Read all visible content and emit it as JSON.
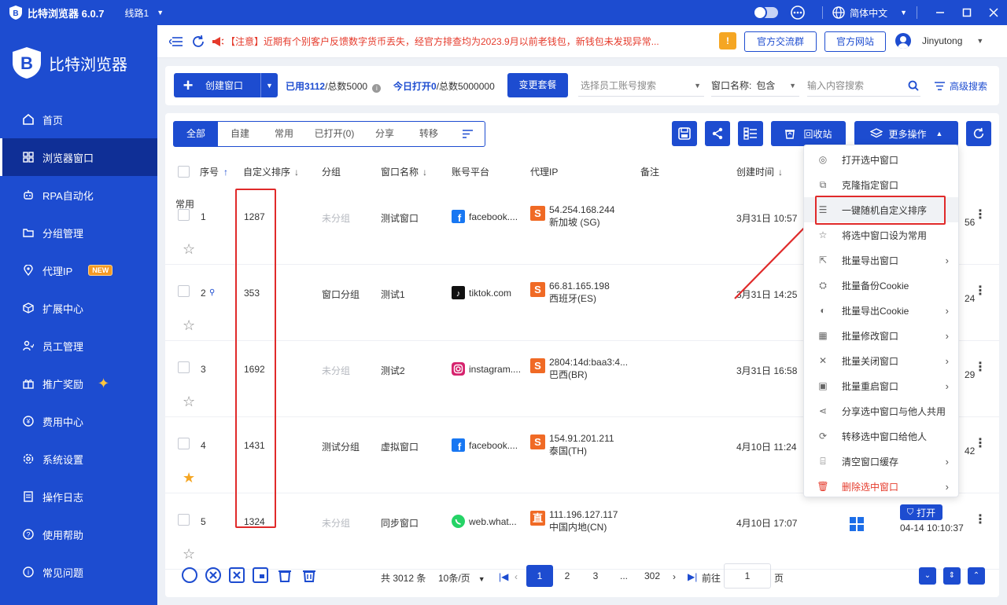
{
  "titlebar": {
    "app_title": "比特浏览器 6.0.7",
    "line_label": "线路1",
    "language": "简体中文"
  },
  "sidebar": {
    "brand": "比特浏览器",
    "items": [
      {
        "label": "首页",
        "icon": "home-icon"
      },
      {
        "label": "浏览器窗口",
        "icon": "grid-icon",
        "active": true
      },
      {
        "label": "RPA自动化",
        "icon": "rpa-icon"
      },
      {
        "label": "分组管理",
        "icon": "folder-icon"
      },
      {
        "label": "代理IP",
        "icon": "location-icon",
        "badge": "NEW"
      },
      {
        "label": "扩展中心",
        "icon": "cube-icon"
      },
      {
        "label": "员工管理",
        "icon": "users-icon"
      },
      {
        "label": "推广奖励",
        "icon": "gift-icon"
      },
      {
        "label": "费用中心",
        "icon": "wallet-icon"
      },
      {
        "label": "系统设置",
        "icon": "settings-icon"
      },
      {
        "label": "操作日志",
        "icon": "log-icon"
      },
      {
        "label": "使用帮助",
        "icon": "help-icon"
      },
      {
        "label": "常见问题",
        "icon": "info-icon"
      }
    ]
  },
  "notice": {
    "text": "【注意】近期有个别客户反馈数字货币丢失，经官方排查均为2023.9月以前老钱包，新钱包未发现异常...",
    "group_btn": "官方交流群",
    "site_btn": "官方网站",
    "username": "Jinyutong"
  },
  "toolbar": {
    "create_label": "创建窗口",
    "used_prefix": "已用",
    "used_value": "3112",
    "used_suffix": "/总数5000",
    "today_prefix": "今日打开",
    "today_value": "0",
    "today_suffix": "/总数5000000",
    "change_plan": "变更套餐",
    "employee_placeholder": "选择员工账号搜索",
    "filter_field": "窗口名称:",
    "filter_op": "包含",
    "search_placeholder": "输入内容搜索",
    "advanced": "高级搜索"
  },
  "tabs": [
    "全部",
    "自建",
    "常用",
    "已打开(0)",
    "分享",
    "转移"
  ],
  "actions": {
    "recycle": "回收站",
    "more": "更多操作"
  },
  "table": {
    "headers": {
      "seq": "序号",
      "custom_sort": "自定义排序",
      "group": "分组",
      "name": "窗口名称",
      "platform": "账号平台",
      "proxy": "代理IP",
      "remark": "备注",
      "created": "创建时间"
    },
    "group_label": "常用",
    "rows": [
      {
        "seq": "1",
        "sort": "1287",
        "group": "未分组",
        "group_muted": true,
        "name": "测试窗口",
        "platform": "facebook....",
        "platform_icon": "facebook-icon",
        "ip": "54.254.168.244",
        "region": "新加坡 (SG)",
        "proxy_icon": "S",
        "created": "3月31日 10:57",
        "right_text": "56",
        "starred": false
      },
      {
        "seq": "2",
        "sort": "353",
        "group": "窗口分组",
        "group_muted": false,
        "name": "测试1",
        "platform": "tiktok.com",
        "platform_icon": "tiktok-icon",
        "ip": "66.81.165.198",
        "region": "西班牙(ES)",
        "proxy_icon": "S",
        "created": "3月31日 14:25",
        "right_text": "24",
        "starred": false
      },
      {
        "seq": "3",
        "sort": "1692",
        "group": "未分组",
        "group_muted": true,
        "name": "测试2",
        "platform": "instagram....",
        "platform_icon": "instagram-icon",
        "ip": "2804:14d:baa3:4...",
        "region": "巴西(BR)",
        "proxy_icon": "S",
        "created": "3月31日 16:58",
        "right_text": "29",
        "starred": false
      },
      {
        "seq": "4",
        "sort": "1431",
        "group": "测试分组",
        "group_muted": false,
        "name": "虚拟窗口",
        "platform": "facebook....",
        "platform_icon": "facebook-icon",
        "ip": "154.91.201.211",
        "region": "泰国(TH)",
        "proxy_icon": "S",
        "created": "4月10日 11:24",
        "right_text": "42",
        "starred": true
      },
      {
        "seq": "5",
        "sort": "1324",
        "group": "未分组",
        "group_muted": true,
        "name": "同步窗口",
        "platform": "web.what...",
        "platform_icon": "whatsapp-icon",
        "ip": "111.196.127.117",
        "region": "中国内地(CN)",
        "proxy_icon": "直",
        "created": "4月10日 17:07",
        "open_label": "打开",
        "open_time": "04-14 10:10:37",
        "starred": false
      }
    ]
  },
  "menu": {
    "items": [
      {
        "label": "打开选中窗口",
        "icon": "chrome-icon",
        "submenu": false
      },
      {
        "label": "克隆指定窗口",
        "icon": "clone-icon",
        "submenu": false
      },
      {
        "label": "一键随机自定义排序",
        "icon": "sort-icon",
        "submenu": false,
        "highlight": true
      },
      {
        "label": "将选中窗口设为常用",
        "icon": "star-icon",
        "submenu": false
      },
      {
        "label": "批量导出窗口",
        "icon": "export-icon",
        "submenu": true
      },
      {
        "label": "批量备份Cookie",
        "icon": "backup-icon",
        "submenu": false
      },
      {
        "label": "批量导出Cookie",
        "icon": "cookie-icon",
        "submenu": true
      },
      {
        "label": "批量修改窗口",
        "icon": "edit-grid-icon",
        "submenu": true
      },
      {
        "label": "批量关闭窗口",
        "icon": "close-icon",
        "submenu": true
      },
      {
        "label": "批量重启窗口",
        "icon": "restart-icon",
        "submenu": true
      },
      {
        "label": "分享选中窗口与他人共用",
        "icon": "share-icon",
        "submenu": false
      },
      {
        "label": "转移选中窗口给他人",
        "icon": "transfer-icon",
        "submenu": false
      },
      {
        "label": "清空窗口缓存",
        "icon": "broom-icon",
        "submenu": true
      },
      {
        "label": "删除选中窗口",
        "icon": "trash-icon",
        "submenu": true,
        "danger": true
      }
    ]
  },
  "pagination": {
    "total": "共 3012 条",
    "page_size": "10条/页",
    "pages": [
      "1",
      "2",
      "3",
      "...",
      "302"
    ],
    "goto_label": "前往",
    "goto_value": "1",
    "page_suffix": "页"
  },
  "colors": {
    "primary": "#1d4cd0",
    "danger": "#e53a2b",
    "highlight_box": "#e02a2a"
  }
}
